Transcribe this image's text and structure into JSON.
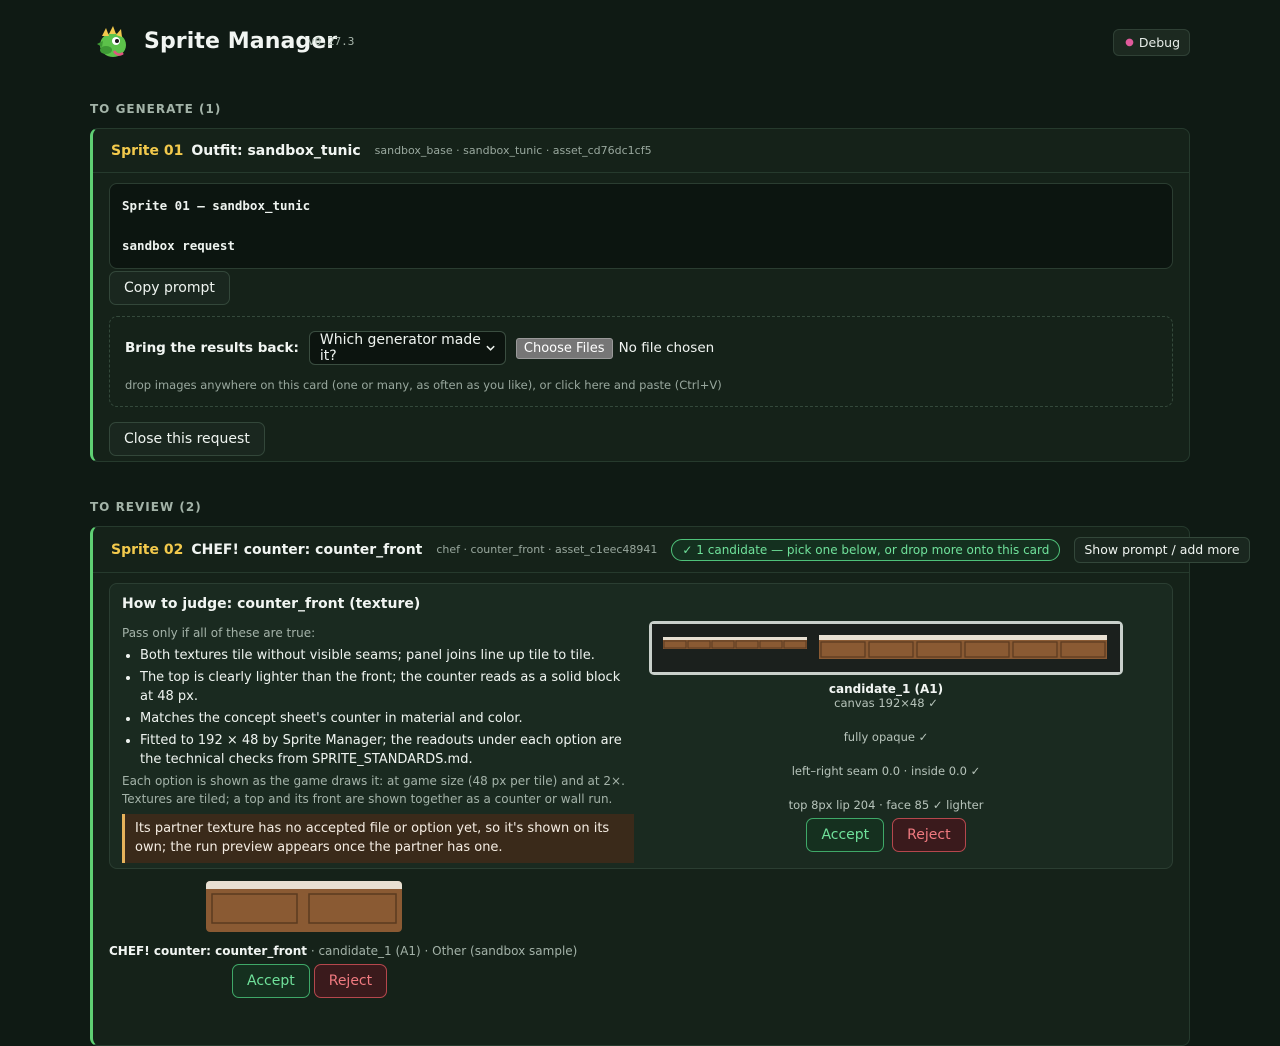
{
  "app": {
    "title": "Sprite Manager",
    "version": "v0.27.3",
    "debug_label": "Debug"
  },
  "sections": {
    "to_generate": "TO GENERATE (1)",
    "to_review": "TO REVIEW (2)"
  },
  "generate_card": {
    "sprite_num": "Sprite 01",
    "title": "Outfit: sandbox_tunic",
    "meta": "sandbox_base · sandbox_tunic · asset_cd76dc1cf5",
    "prompt_line1": "Sprite 01 — sandbox_tunic",
    "prompt_line2": "sandbox request",
    "copy_label": "Copy prompt",
    "bring_label": "Bring the results back:",
    "generator_placeholder": "Which generator made it?",
    "choose_files": "Choose Files",
    "no_file": "No file chosen",
    "drop_hint": "drop images anywhere on this card (one or many, as often as you like), or click here and paste (Ctrl+V)",
    "close_label": "Close this request"
  },
  "review_card": {
    "sprite_num": "Sprite 02",
    "title": "CHEF! counter: counter_front",
    "meta": "chef · counter_front · asset_c1eec48941",
    "candidate_pill": "✓ 1 candidate — pick one below, or drop more onto this card",
    "show_prompt_label": "Show prompt / add more",
    "judge_title": "How to judge: counter_front (texture)",
    "pass_note": "Pass only if all of these are true:",
    "criteria": [
      "Both textures tile without visible seams; panel joins line up tile to tile.",
      "The top is clearly lighter than the front; the counter reads as a solid block at 48 px.",
      "Matches the concept sheet's counter in material and color.",
      "Fitted to 192 × 48 by Sprite Manager; the readouts under each option are the technical checks from SPRITE_STANDARDS.md."
    ],
    "each_note": "Each option is shown as the game draws it: at game size (48 px per tile) and at 2×. Textures are tiled; a top and its front are shown together as a counter or wall run.",
    "warning": "Its partner texture has no accepted file or option yet, so it's shown on its own; the run preview appears once the partner has one.",
    "candidate": {
      "name": "candidate_1 (A1)",
      "canvas": "canvas 192×48 ✓",
      "opaque": "fully opaque ✓",
      "seam": "left–right seam 0.0 · inside 0.0 ✓",
      "lip": "top 8px lip 204 · face 85 ✓ lighter",
      "accept": "Accept",
      "reject": "Reject"
    },
    "run": {
      "caption_bold": "CHEF! counter: counter_front",
      "caption_rest": " · candidate_1 (A1) · Other (sandbox sample)",
      "accept": "Accept",
      "reject": "Reject"
    }
  },
  "colors": {
    "accent_green": "#5fcf73",
    "sprite_num_yellow": "#f2c94c",
    "wood": "#8a5a33",
    "warning_amber": "#e5b25b"
  },
  "icons": {
    "logo": "dragon-logo-icon",
    "debug": "bug-icon",
    "select": "chevron-down-icon"
  }
}
